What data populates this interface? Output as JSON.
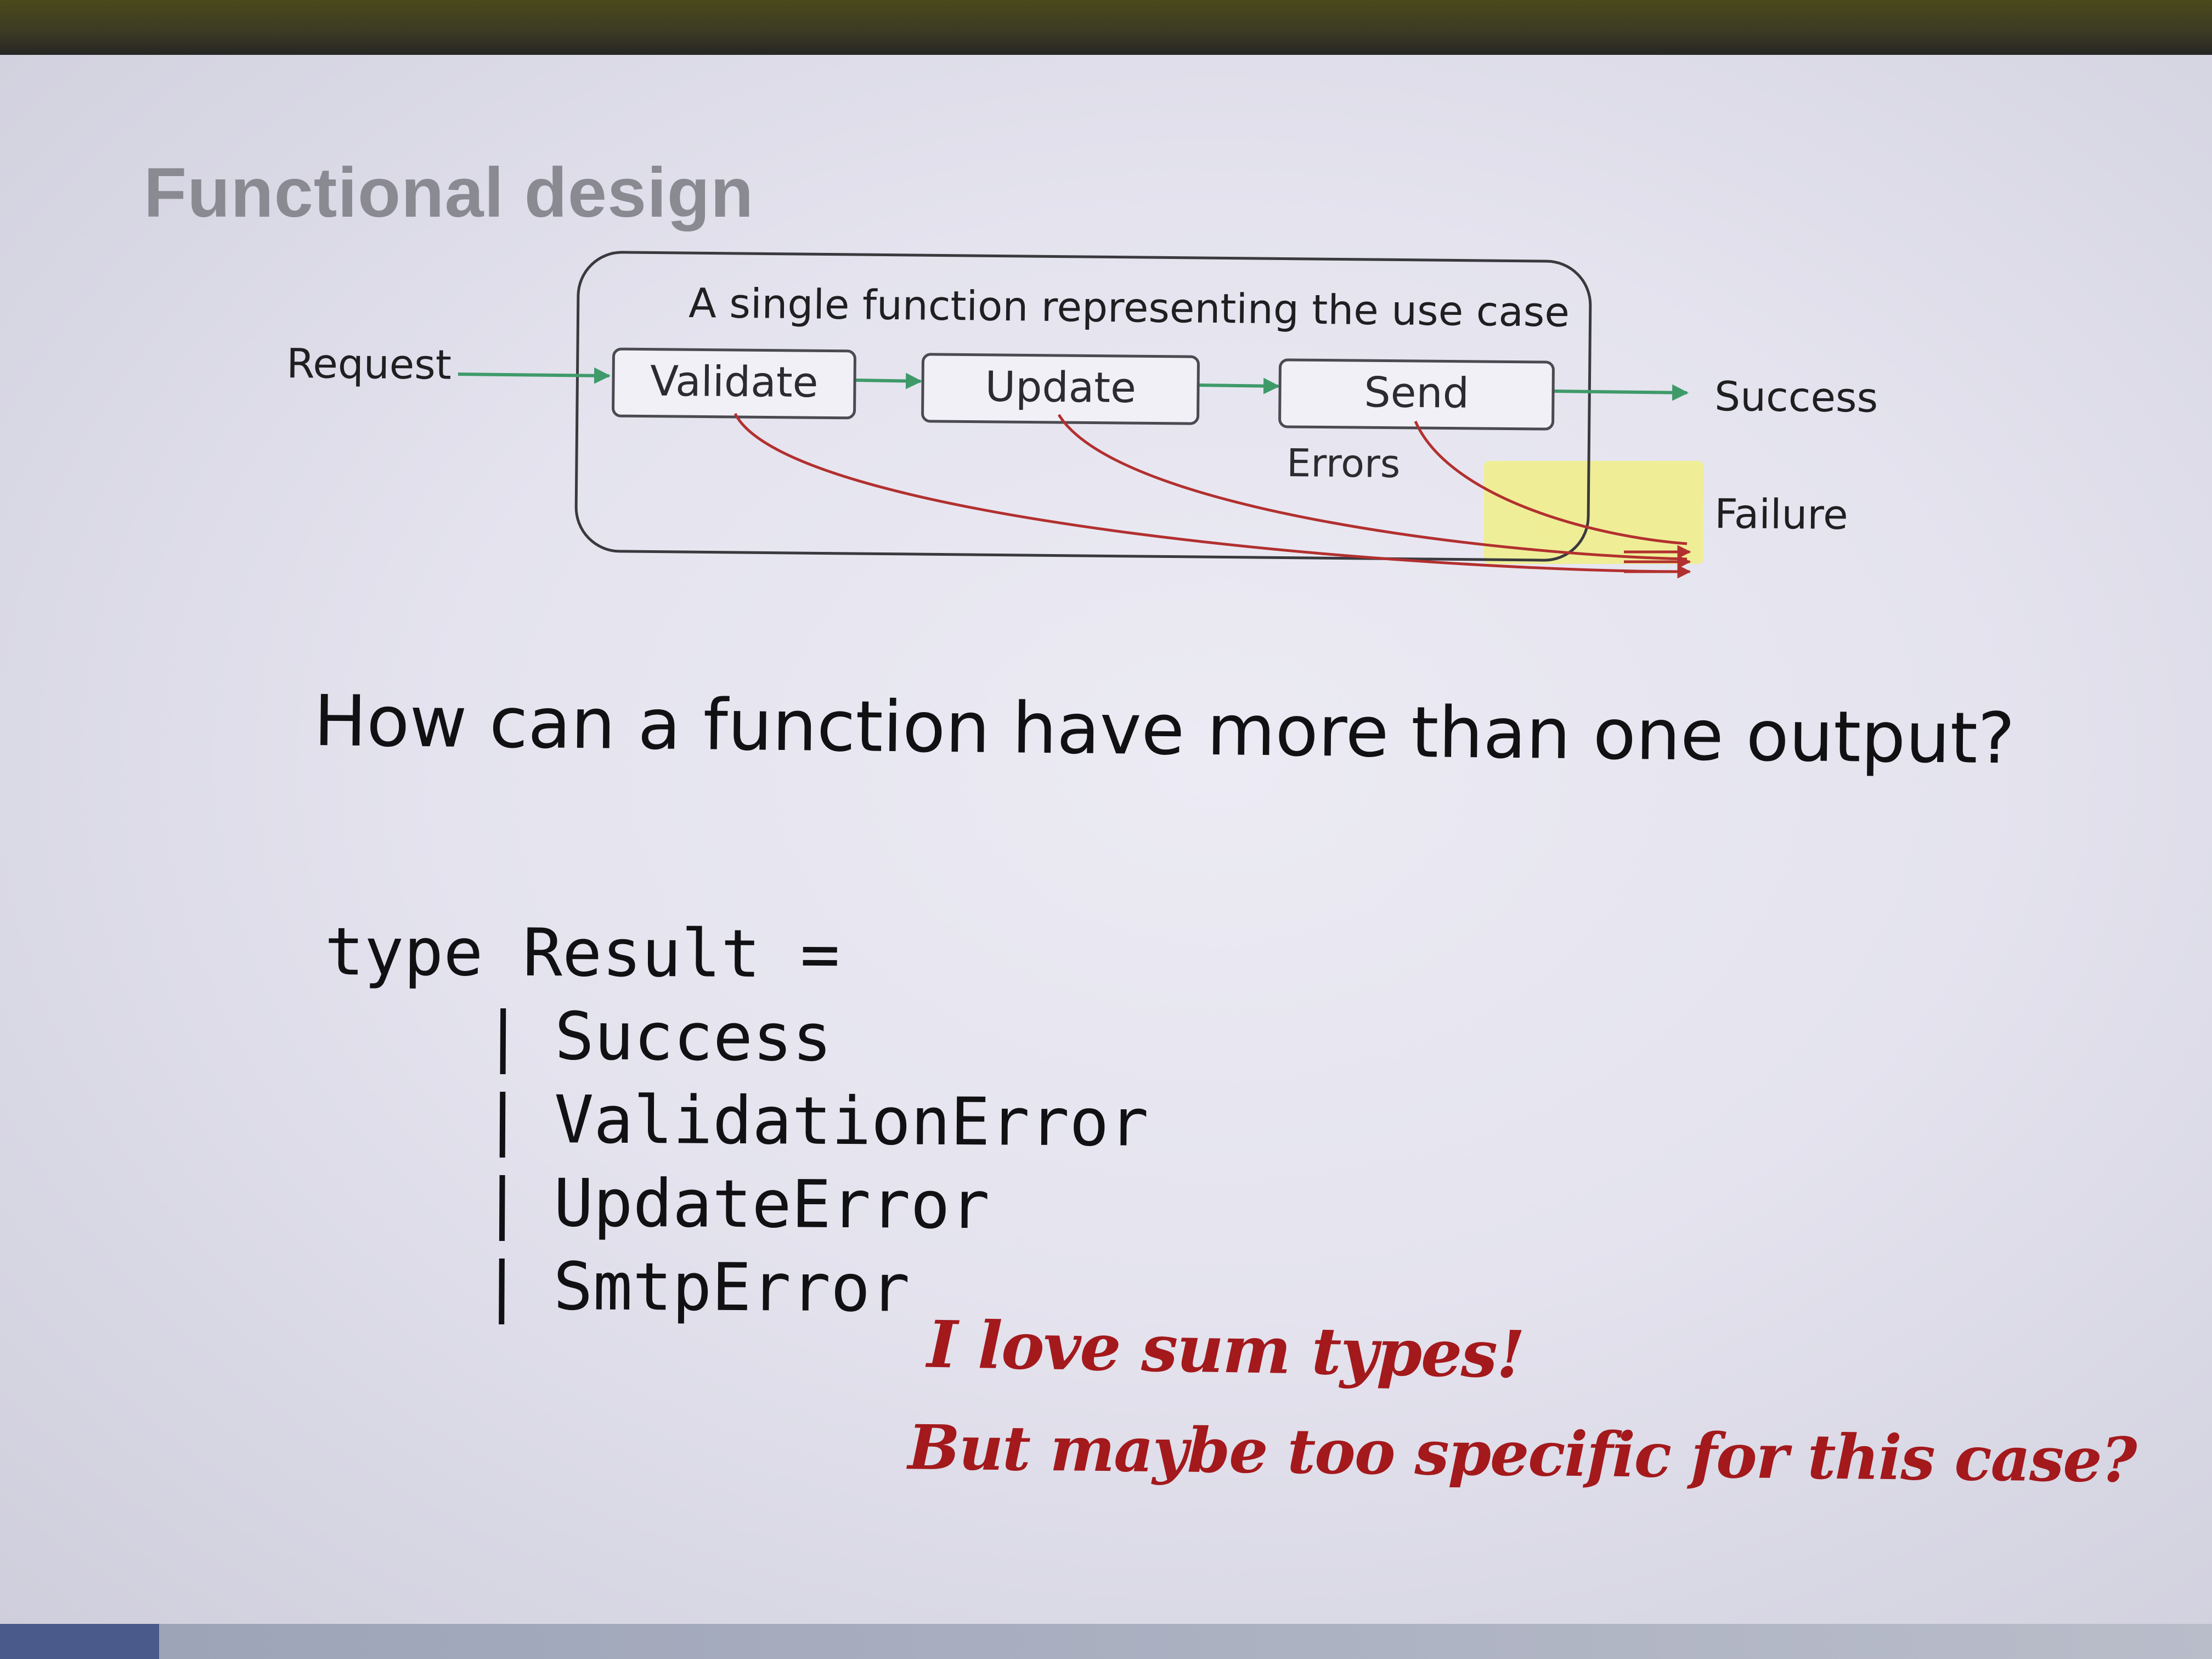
{
  "slide": {
    "title": "Functional design",
    "diagram": {
      "caption": "A single function representing the use case",
      "input": "Request",
      "steps": [
        "Validate",
        "Update",
        "Send"
      ],
      "errors_label": "Errors",
      "outputs": {
        "success": "Success",
        "failure": "Failure"
      },
      "colors": {
        "success_flow": "#3f9a6a",
        "error_flow": "#b2302f",
        "highlight": "#f2f07a"
      }
    },
    "question": "How can a function have more than one output?",
    "code": {
      "header": "type Result =",
      "cases": [
        "Success",
        "ValidationError",
        "UpdateError",
        "SmtpError"
      ],
      "case_prefix": "|"
    },
    "handwritten_notes": [
      "I love sum types!",
      "But maybe too specific for this case?"
    ]
  }
}
